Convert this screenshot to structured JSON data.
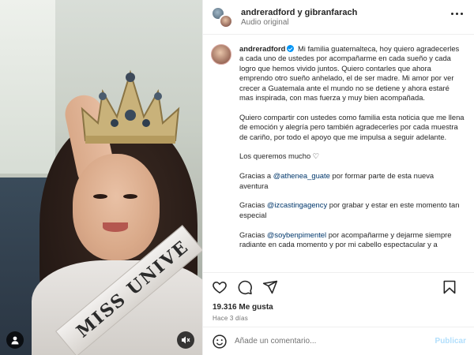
{
  "header": {
    "users": "andreradford y gibranfarach",
    "audio": "Audio original"
  },
  "caption": {
    "username": "andreradford",
    "paragraphs": [
      "Mi familia guatemalteca, hoy quiero agradecerles a cada uno de ustedes por acompañarme en cada sueño y cada logro que hemos vivido juntos. Quiero contarles que ahora emprendo otro sueño anhelado, el de ser madre. Mi amor por ver crecer a Guatemala ante el mundo no se detiene y ahora estaré mas inspirada, con mas fuerza y muy bien acompañada.",
      "Quiero compartir con ustedes como familia esta noticia que me llena de emoción y alegría pero también agradecerles por cada muestra de cariño, por todo el apoyo que me impulsa a seguir adelante.",
      "Los queremos mucho ♡"
    ],
    "thanks": [
      {
        "prefix": "Gracias a ",
        "handle": "@athenea_guate",
        "suffix": " por formar parte de esta nueva aventura"
      },
      {
        "prefix": "Gracias ",
        "handle": "@izcastingagency",
        "suffix": " por grabar y estar en este momento tan especial"
      },
      {
        "prefix": "Gracias ",
        "handle": "@soybenpimentel",
        "suffix": " por acompañarme y dejarme siempre radiante en cada momento y por mi cabello espectacular y a"
      }
    ]
  },
  "media": {
    "sash_text": "MISS UNIVE"
  },
  "stats": {
    "likes": "19.316 Me gusta",
    "time": "Hace 3 días"
  },
  "comment": {
    "placeholder": "Añade un comentario...",
    "publish": "Publicar"
  },
  "colors": {
    "link": "#00376b",
    "verified": "#0095f6",
    "publish_disabled": "#b2dffc"
  },
  "icons": [
    "heart-icon",
    "comment-icon",
    "share-icon",
    "bookmark-icon",
    "emoji-icon",
    "more-icon",
    "verified-icon",
    "mute-icon",
    "person-tag-icon"
  ]
}
